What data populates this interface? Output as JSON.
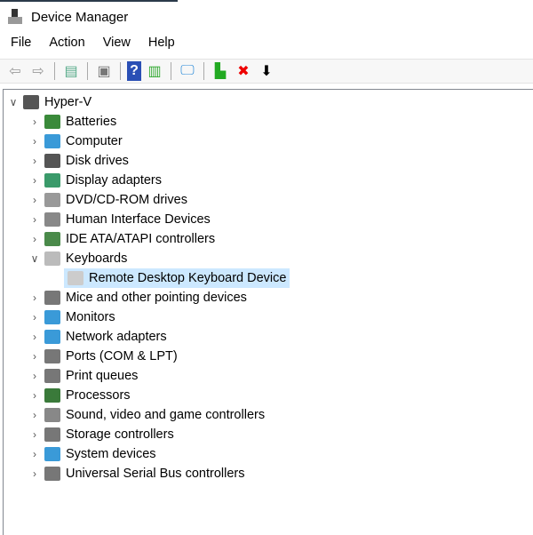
{
  "window": {
    "title": "Device Manager"
  },
  "menu": [
    "File",
    "Action",
    "View",
    "Help"
  ],
  "toolbar": [
    {
      "name": "back-icon",
      "glyph": "⇦",
      "color": "#999"
    },
    {
      "name": "forward-icon",
      "glyph": "⇨",
      "color": "#999"
    },
    {
      "sep": true
    },
    {
      "name": "show-hide-console-tree-icon",
      "glyph": "▤",
      "color": "#5a8"
    },
    {
      "sep": true
    },
    {
      "name": "properties-icon",
      "glyph": "▣",
      "color": "#777"
    },
    {
      "sep": true
    },
    {
      "name": "help-icon",
      "glyph": "?",
      "color": "#fff",
      "bg": "#2a4fb5"
    },
    {
      "name": "show-action-pane-icon",
      "glyph": "▥",
      "color": "#3a3"
    },
    {
      "sep": true
    },
    {
      "name": "scan-hardware-icon",
      "glyph": "🖵",
      "color": "#2a8ad8"
    },
    {
      "sep": true
    },
    {
      "name": "update-driver-icon",
      "glyph": "▙",
      "color": "#2a2"
    },
    {
      "name": "uninstall-icon",
      "glyph": "✖",
      "color": "#e00"
    },
    {
      "name": "disable-device-icon",
      "glyph": "⬇",
      "color": "#000"
    }
  ],
  "tree": {
    "root": "Hyper-V",
    "categories": [
      {
        "label": "Batteries",
        "color": "#3a8a3a"
      },
      {
        "label": "Computer",
        "color": "#3a9ad8"
      },
      {
        "label": "Disk drives",
        "color": "#555"
      },
      {
        "label": "Display adapters",
        "color": "#3a9a6a"
      },
      {
        "label": "DVD/CD-ROM drives",
        "color": "#999"
      },
      {
        "label": "Human Interface Devices",
        "color": "#888"
      },
      {
        "label": "IDE ATA/ATAPI controllers",
        "color": "#4a8a4a"
      },
      {
        "label": "Keyboards",
        "color": "#bbb",
        "expanded": true,
        "children": [
          "Remote Desktop Keyboard Device"
        ]
      },
      {
        "label": "Mice and other pointing devices",
        "color": "#777"
      },
      {
        "label": "Monitors",
        "color": "#3a9ad8"
      },
      {
        "label": "Network adapters",
        "color": "#3a9ad8"
      },
      {
        "label": "Ports (COM & LPT)",
        "color": "#777"
      },
      {
        "label": "Print queues",
        "color": "#777"
      },
      {
        "label": "Processors",
        "color": "#3a7a3a"
      },
      {
        "label": "Sound, video and game controllers",
        "color": "#888"
      },
      {
        "label": "Storage controllers",
        "color": "#777"
      },
      {
        "label": "System devices",
        "color": "#3a9ad8"
      },
      {
        "label": "Universal Serial Bus controllers",
        "color": "#777"
      }
    ]
  }
}
